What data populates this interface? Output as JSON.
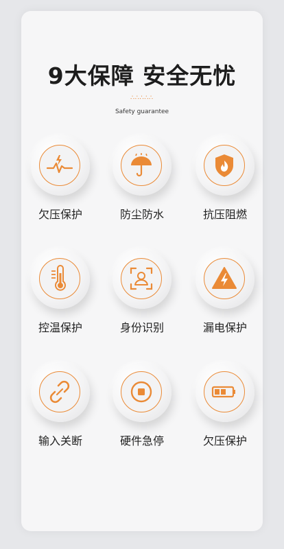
{
  "header": {
    "title": "9大保障 安全无忧",
    "dots": "∴∴∴∴∴",
    "subtitle": "Safety guarantee"
  },
  "accent_color": "#ea8a36",
  "features": [
    {
      "label": "欠压保护",
      "icon": "undervoltage-icon"
    },
    {
      "label": "防尘防水",
      "icon": "umbrella-icon"
    },
    {
      "label": "抗压阻燃",
      "icon": "flame-shield-icon"
    },
    {
      "label": "控温保护",
      "icon": "thermometer-icon"
    },
    {
      "label": "身份识别",
      "icon": "face-id-icon"
    },
    {
      "label": "漏电保护",
      "icon": "leakage-warning-icon"
    },
    {
      "label": "输入关断",
      "icon": "unlink-icon"
    },
    {
      "label": "硬件急停",
      "icon": "emergency-stop-icon"
    },
    {
      "label": "欠压保护",
      "icon": "low-battery-icon"
    }
  ]
}
